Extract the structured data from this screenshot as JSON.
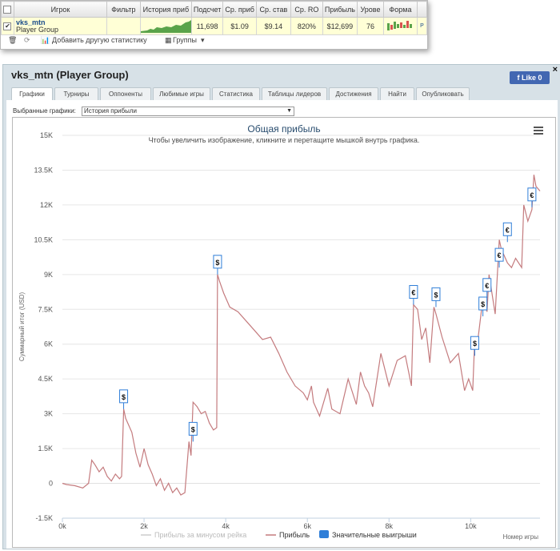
{
  "stats_table": {
    "columns": [
      "",
      "Игрок",
      "Фильтр",
      "История приб",
      "Подсчет",
      "Ср. приб",
      "Ср. став",
      "Ср. RO",
      "Прибыль",
      "Урове",
      "Форма"
    ],
    "row": {
      "player_name": "vks_mtn",
      "player_group": "Player Group",
      "filter": "",
      "games": "11,698",
      "avg_profit": "$1.09",
      "avg_stake": "$9.14",
      "avg_roi": "820%",
      "profit": "$12,699",
      "level": "76",
      "extra": "P"
    }
  },
  "toolbar": {
    "add_stats_label": "Добавить другую статистику",
    "groups_label": "Группы"
  },
  "panel": {
    "title": "vks_mtn (Player Group)",
    "like_label": "Like 0",
    "close_symbol": "×",
    "tabs": [
      "Графики",
      "Турниры",
      "Оппоненты",
      "Любимые игры",
      "Статистика",
      "Таблицы лидеров",
      "Достижения",
      "Найти",
      "Опубликовать"
    ],
    "active_tab": "Графики",
    "graph_select_label": "Выбранные графики:",
    "graph_select_value": "История прибыли"
  },
  "chart_data": {
    "type": "line",
    "title": "Общая прибыль",
    "subtitle": "Чтобы увеличить изображение, кликните и перетащите мышкой внутрь графика.",
    "xlabel": "Номер игры",
    "ylabel": "Суммарный итог (USD)",
    "xlim": [
      0,
      11698
    ],
    "ylim": [
      -1500,
      15000
    ],
    "x_ticks": [
      "0k",
      "2k",
      "4k",
      "6k",
      "8k",
      "10k"
    ],
    "x_tick_values": [
      0,
      2000,
      4000,
      6000,
      8000,
      10000
    ],
    "y_ticks": [
      "-1.5K",
      "0",
      "1.5K",
      "3K",
      "4.5K",
      "6K",
      "7.5K",
      "9K",
      "10.5K",
      "12K",
      "13.5K",
      "15K"
    ],
    "y_tick_values": [
      -1500,
      0,
      1500,
      3000,
      4500,
      6000,
      7500,
      9000,
      10500,
      12000,
      13500,
      15000
    ],
    "grid": true,
    "legend_position": "bottom",
    "legend": [
      {
        "name": "Прибыль за минусом рейка",
        "color": "#cccccc",
        "visible": false
      },
      {
        "name": "Прибыль",
        "color": "#c47b7e",
        "visible": true
      },
      {
        "name": "Значительные выигрыши",
        "color": "#2f7ed8",
        "visible": true
      }
    ],
    "series": [
      {
        "name": "Прибыль",
        "color": "#c47b7e",
        "x": [
          0,
          100,
          300,
          500,
          640,
          720,
          800,
          900,
          1000,
          1100,
          1200,
          1300,
          1400,
          1450,
          1500,
          1550,
          1700,
          1800,
          1900,
          2000,
          2100,
          2200,
          2300,
          2400,
          2500,
          2600,
          2700,
          2800,
          2900,
          3000,
          3100,
          3150,
          3200,
          3250,
          3300,
          3400,
          3500,
          3600,
          3700,
          3780,
          3800,
          3850,
          3950,
          4100,
          4300,
          4500,
          4700,
          4900,
          5100,
          5300,
          5500,
          5700,
          5900,
          6000,
          6100,
          6150,
          6300,
          6500,
          6600,
          6800,
          7000,
          7200,
          7300,
          7400,
          7500,
          7600,
          7800,
          8000,
          8200,
          8400,
          8550,
          8600,
          8700,
          8800,
          8900,
          9000,
          9100,
          9150,
          9300,
          9500,
          9700,
          9850,
          9950,
          10050,
          10100,
          10150,
          10300,
          10400,
          10450,
          10600,
          10700,
          10750,
          10900,
          11000,
          11100,
          11250,
          11300,
          11400,
          11500,
          11550,
          11600,
          11698
        ],
        "y": [
          0,
          -50,
          -100,
          -200,
          0,
          1000,
          800,
          500,
          700,
          300,
          100,
          400,
          200,
          300,
          3200,
          2800,
          2200,
          1300,
          700,
          1500,
          800,
          400,
          -100,
          200,
          -300,
          0,
          -400,
          -200,
          -500,
          -400,
          1800,
          1200,
          3500,
          3400,
          3300,
          3000,
          3100,
          2600,
          2300,
          2400,
          9000,
          8700,
          8200,
          7600,
          7400,
          7000,
          6600,
          6200,
          6300,
          5600,
          4800,
          4200,
          3900,
          3600,
          4200,
          3500,
          2900,
          4100,
          3200,
          3000,
          4500,
          3400,
          4800,
          4200,
          3900,
          3300,
          5600,
          4200,
          5300,
          5500,
          4200,
          7700,
          7500,
          6200,
          6700,
          5200,
          7600,
          7300,
          6300,
          5200,
          5600,
          4000,
          4500,
          4000,
          6200,
          5800,
          8000,
          7400,
          9000,
          7300,
          10500,
          10100,
          9500,
          9300,
          9700,
          9300,
          12000,
          11300,
          11800,
          13300,
          12800,
          12600
        ]
      },
      {
        "name": "Значительные выигрыши",
        "color": "#2f7ed8",
        "type": "flags",
        "x": [
          1500,
          3200,
          3800,
          8600,
          9150,
          10100,
          10300,
          10400,
          10700,
          10900,
          11500
        ],
        "y": [
          3200,
          1800,
          9000,
          7700,
          7600,
          5500,
          7200,
          8000,
          9300,
          10400,
          11900
        ],
        "labels": [
          "$",
          "$",
          "$",
          "€",
          "$",
          "$",
          "$",
          "€",
          "€",
          "€",
          "€"
        ]
      }
    ]
  }
}
